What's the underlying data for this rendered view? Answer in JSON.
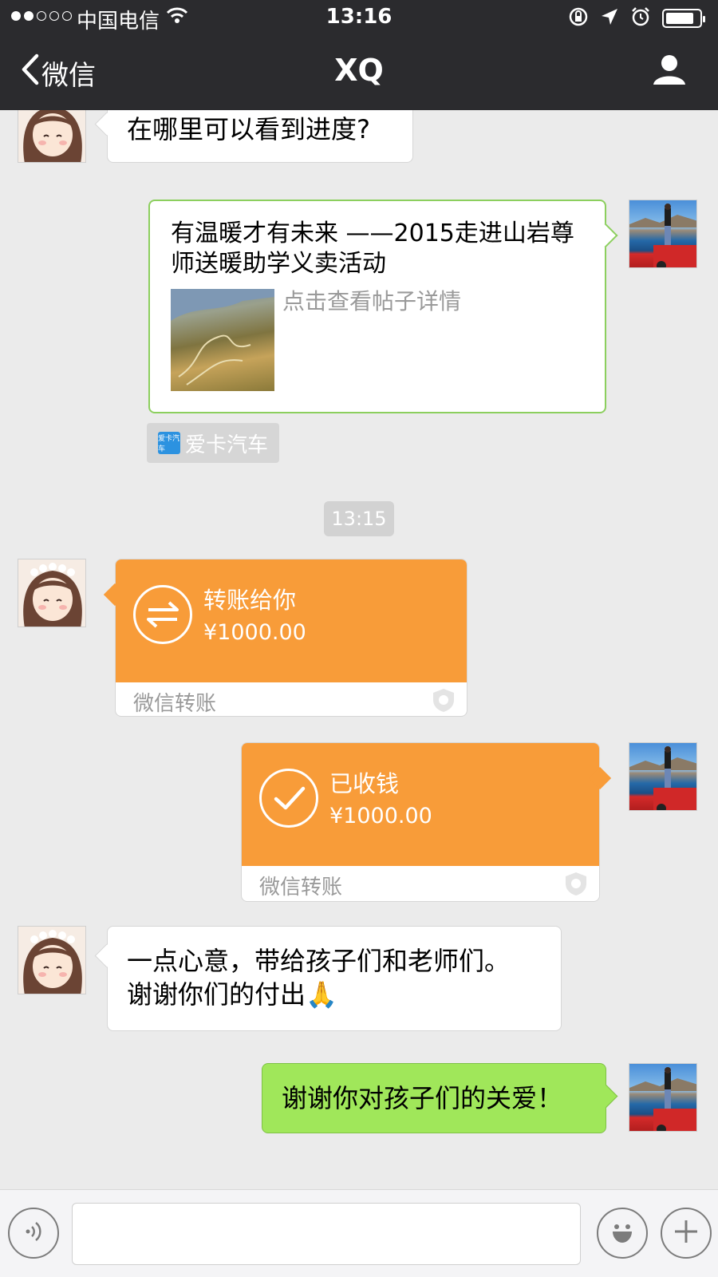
{
  "status_bar": {
    "carrier": "中国电信",
    "time": "13:16",
    "signal_filled": 2,
    "signal_total": 5,
    "battery_level": 0.85
  },
  "nav": {
    "back_label": "微信",
    "title": "XQ"
  },
  "messages": {
    "m1": {
      "text": "在哪里可以看到进度?"
    },
    "link_card": {
      "title": "有温暖才有未来 ——2015走进山岩尊师送暖助学义卖活动",
      "description": "点击查看帖子详情",
      "source": "爱卡汽车",
      "source_logo_text": "爱卡汽车"
    },
    "time_divider": "13:15",
    "transfer_sent": {
      "label": "转账给你",
      "amount": "¥1000.00",
      "footer": "微信转账"
    },
    "transfer_received": {
      "label": "已收钱",
      "amount": "¥1000.00",
      "footer": "微信转账"
    },
    "m2": {
      "line1": "一点心意，带给孩子们和老师们。",
      "line2": "谢谢你们的付出",
      "emoji": "🙏"
    },
    "m3": {
      "text": "谢谢你对孩子们的关爱！"
    }
  },
  "input_bar": {
    "value": "",
    "placeholder": ""
  },
  "colors": {
    "nav_bg": "#2b2b2e",
    "chat_bg": "#ebebeb",
    "bubble_green": "#a0e75a",
    "transfer_orange": "#f89c39"
  },
  "icons": [
    "back-chevron-icon",
    "profile-icon",
    "wifi-icon",
    "location-icon",
    "alarm-icon",
    "battery-icon",
    "transfer-arrows-icon",
    "checkmark-icon",
    "shield-icon",
    "voice-icon",
    "emoji-icon",
    "plus-icon"
  ]
}
